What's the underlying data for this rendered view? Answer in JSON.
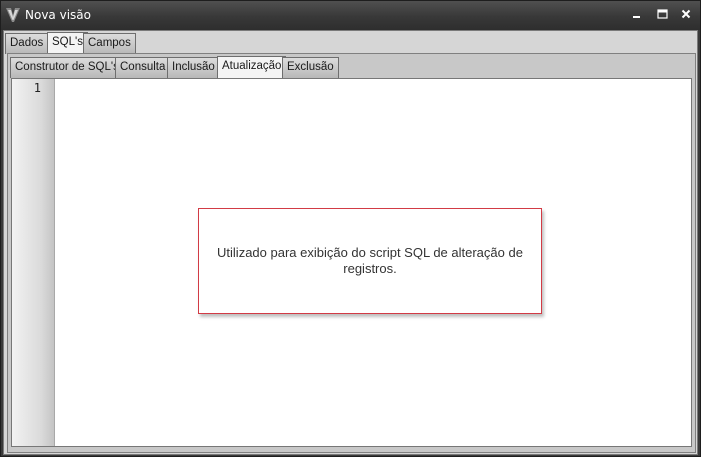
{
  "window": {
    "title": "Nova visão",
    "controls": {
      "minimize": "minimize-icon",
      "maximize": "maximize-icon",
      "close": "close-icon"
    }
  },
  "main_tabs": {
    "items": [
      {
        "label": "Dados",
        "active": false
      },
      {
        "label": "SQL's",
        "active": true
      },
      {
        "label": "Campos",
        "active": false
      }
    ]
  },
  "sql_tabs": {
    "items": [
      {
        "label": "Construtor de SQL's",
        "active": false
      },
      {
        "label": "Consulta",
        "active": false
      },
      {
        "label": "Inclusão",
        "active": false
      },
      {
        "label": "Atualização",
        "active": true
      },
      {
        "label": "Exclusão",
        "active": false
      }
    ]
  },
  "editor": {
    "line_numbers": [
      "1"
    ],
    "content": ""
  },
  "tooltip": {
    "text": "Utilizado para exibição do script SQL de alteração de registros.",
    "border_color": "#d23b45"
  },
  "colors": {
    "title_bar": "#3a3a3a",
    "panel": "#d6d6d6"
  }
}
